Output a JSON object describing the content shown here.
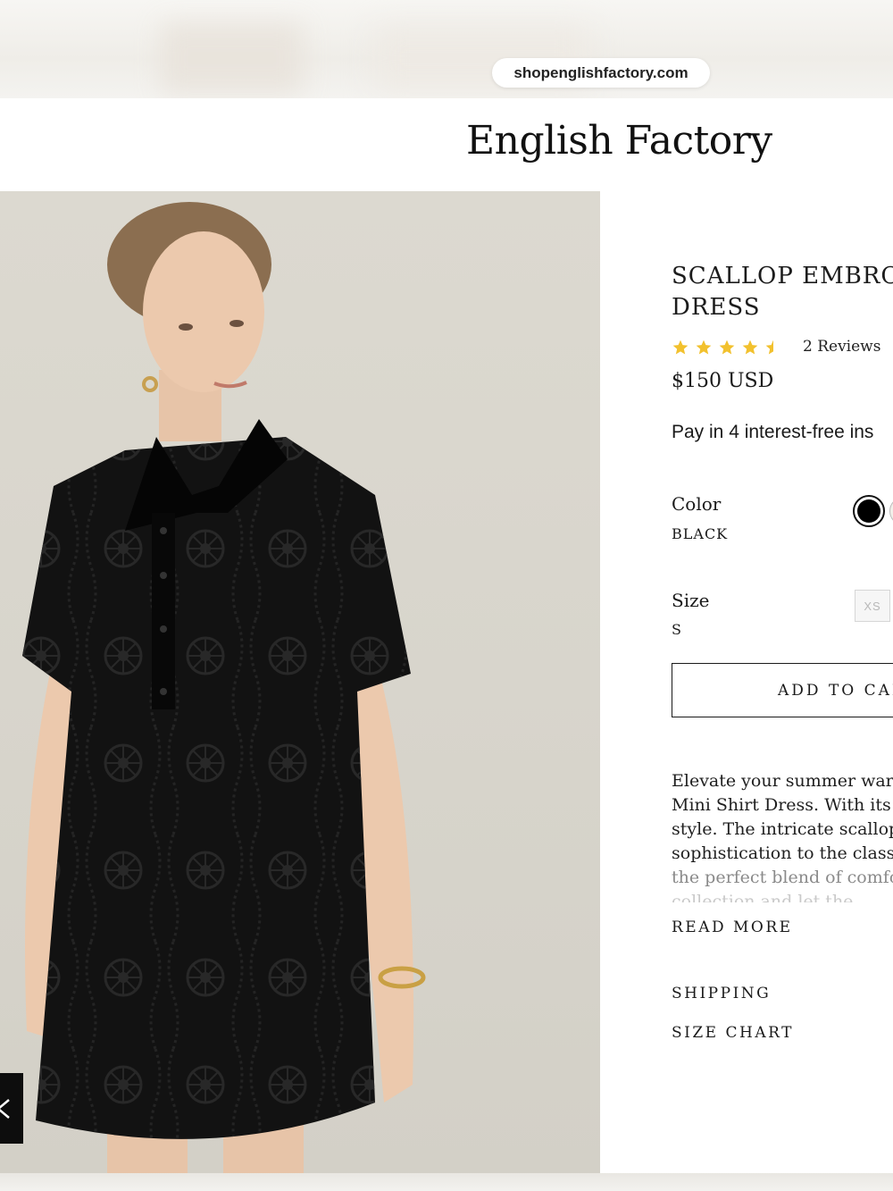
{
  "browser": {
    "url": "shopenglishfactory.com"
  },
  "header": {
    "logo": "English Factory"
  },
  "product": {
    "title_line1": "SCALLOP EMBROI",
    "title_line2": "DRESS",
    "rating": 4.5,
    "reviews_label": "2 Reviews",
    "price": "$150 USD",
    "installments": "Pay in 4 interest-free ins",
    "color": {
      "label": "Color",
      "selected": "BLACK",
      "swatches": [
        "#000000",
        "#f2f0ea"
      ]
    },
    "size": {
      "label": "Size",
      "selected": "S",
      "options": [
        "XS",
        ""
      ]
    },
    "add_to_cart": "ADD TO CAR",
    "description_lines": [
      "Elevate your summer ward",
      "Mini Shirt Dress. With its",
      "style. The intricate scallop",
      "sophistication to the classi",
      "the perfect blend of comfo",
      "collection and let the..."
    ],
    "read_more": "READ MORE",
    "shipping": "SHIPPING",
    "size_chart": "SIZE CHART"
  },
  "colors": {
    "star": "#f2c12e",
    "text": "#1a1a1a",
    "image_bg": "#d9d6cd"
  }
}
